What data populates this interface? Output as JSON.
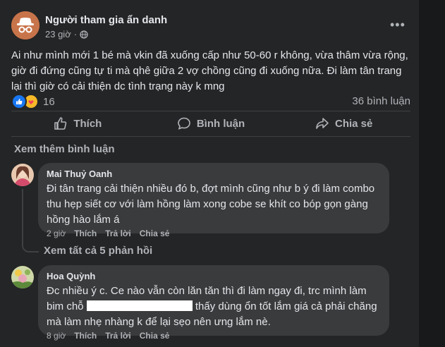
{
  "post": {
    "author": "Người tham gia ẩn danh",
    "time": "23 giờ",
    "more_label": "•••",
    "text": "Ai như mình mới 1 bé mà vkin đã xuống cấp như 50-60 r không, vừa thâm vừa rộng, giờ đi đứng cũng tự ti mà qhê giữa 2 vợ chồng cũng đi xuống nữa. Đi làm tân trang lại thì giờ có cải thiện dc tình trạng này k mng",
    "reaction_count": "16",
    "comment_count": "36 bình luận"
  },
  "actions": {
    "like": "Thích",
    "comment": "Bình luận",
    "share": "Chia sẻ"
  },
  "see_more_comments": "Xem thêm bình luận",
  "comments": [
    {
      "name": "Mai Thuỷ Oanh",
      "text": "Đi tân trang cải thiện nhiều đó b, đợt mình cũng như b ý đi làm combo thu hẹp siết cơ với làm hồng làm xong cobe se khít co bóp gọn gàng hồng hào lắm á",
      "time": "2 giờ",
      "like": "Thích",
      "reply": "Trả lời",
      "share": "Chia sẻ"
    },
    {
      "name": "Hoa Quỳnh",
      "text_before": "Đc nhiều ý c. Ce nào vẫn còn lăn tăn thì đi làm ngay đi, trc mình làm bim chỗ",
      "text_after": "thấy dùng ổn tốt lắm giá cả phải chăng mà làm nhẹ nhàng k để lại sẹo nên ưng lắm nè.",
      "time": "8 giờ",
      "like": "Thích",
      "reply": "Trả lời",
      "share": "Chia sẻ"
    }
  ],
  "view_replies": "Xem tất cả 5 phản hồi",
  "colors": {
    "page_bg": "#18191a",
    "card_bg": "#242526",
    "bubble_bg": "#3a3b3c",
    "like_blue": "#1877f2",
    "text": "#e4e6eb",
    "muted": "#b0b3b8"
  }
}
